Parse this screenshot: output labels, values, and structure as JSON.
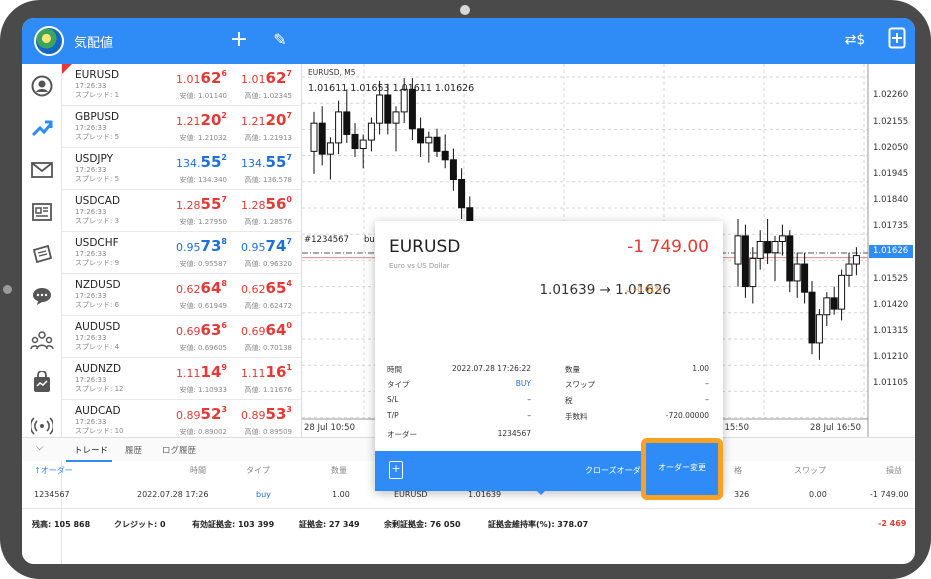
{
  "header": {
    "title": "気配値"
  },
  "quotes": [
    {
      "symbol": "EURUSD",
      "time": "17:26:33",
      "spread": "スプレッド: 1",
      "bid_main": "1.01",
      "bid_big": "62",
      "bid_sup": "6",
      "ask_main": "1.01",
      "ask_big": "62",
      "ask_sup": "7",
      "low": "安値: 1.01140",
      "high": "高値: 1.02345",
      "color": "red"
    },
    {
      "symbol": "GBPUSD",
      "time": "17:26:33",
      "spread": "スプレッド: 5",
      "bid_main": "1.21",
      "bid_big": "20",
      "bid_sup": "2",
      "ask_main": "1.21",
      "ask_big": "20",
      "ask_sup": "7",
      "low": "安値: 1.21032",
      "high": "高値: 1.21913",
      "color": "red"
    },
    {
      "symbol": "USDJPY",
      "time": "17:26:33",
      "spread": "スプレッド: 5",
      "bid_main": "134.",
      "bid_big": "55",
      "bid_sup": "2",
      "ask_main": "134.",
      "ask_big": "55",
      "ask_sup": "7",
      "low": "安値: 134.340",
      "high": "高値: 136.578",
      "color": "blue"
    },
    {
      "symbol": "USDCAD",
      "time": "17:26:33",
      "spread": "スプレッド: 3",
      "bid_main": "1.28",
      "bid_big": "55",
      "bid_sup": "7",
      "ask_main": "1.28",
      "ask_big": "56",
      "ask_sup": "0",
      "low": "安値: 1.27950",
      "high": "高値: 1.28576",
      "color": "red"
    },
    {
      "symbol": "USDCHF",
      "time": "17:26:33",
      "spread": "スプレッド: 9",
      "bid_main": "0.95",
      "bid_big": "73",
      "bid_sup": "8",
      "ask_main": "0.95",
      "ask_big": "74",
      "ask_sup": "7",
      "low": "安値: 0.95587",
      "high": "高値: 0.96320",
      "color": "blue"
    },
    {
      "symbol": "NZDUSD",
      "time": "17:26:33",
      "spread": "スプレッド: 6",
      "bid_main": "0.62",
      "bid_big": "64",
      "bid_sup": "8",
      "ask_main": "0.62",
      "ask_big": "65",
      "ask_sup": "4",
      "low": "安値: 0.61949",
      "high": "高値: 0.62472",
      "color": "red"
    },
    {
      "symbol": "AUDUSD",
      "time": "17:26:33",
      "spread": "スプレッド: 4",
      "bid_main": "0.69",
      "bid_big": "63",
      "bid_sup": "6",
      "ask_main": "0.69",
      "ask_big": "64",
      "ask_sup": "0",
      "low": "安値: 0.69605",
      "high": "高値: 0.70138",
      "color": "red"
    },
    {
      "symbol": "AUDNZD",
      "time": "17:26:33",
      "spread": "スプレッド: 12",
      "bid_main": "1.11",
      "bid_big": "14",
      "bid_sup": "9",
      "ask_main": "1.11",
      "ask_big": "16",
      "ask_sup": "1",
      "low": "安値: 1.10933",
      "high": "高値: 1.11676",
      "color": "red"
    },
    {
      "symbol": "AUDCAD",
      "time": "17:26:33",
      "spread": "スプレッド: 10",
      "bid_main": "0.89",
      "bid_big": "52",
      "bid_sup": "3",
      "ask_main": "0.89",
      "ask_big": "53",
      "ask_sup": "3",
      "low": "安値: 0.89002",
      "high": "高値: 0.89509",
      "color": "red"
    }
  ],
  "chart": {
    "title": "EURUSD, M5",
    "ohlc": "1.01611 1.01653 1.01611 1.01626",
    "order_label": "#1234567",
    "order_label2": "bu",
    "current_price": "1.01626",
    "price_labels": [
      "1.02260",
      "1.02155",
      "1.02050",
      "1.01945",
      "1.01840",
      "1.01735",
      "1.01525",
      "1.01420",
      "1.01315",
      "1.01210",
      "1.01105"
    ],
    "time_labels": [
      "28 Jul 10:50",
      "28 Jul 15:50",
      "28 Jul 16:50"
    ]
  },
  "chart_data": {
    "type": "candlestick",
    "title": "EURUSD, M5",
    "ylim": [
      1.0105,
      1.0231
    ],
    "candles_left": [
      [
        1.02,
        1.0214,
        1.0192,
        1.021
      ],
      [
        1.021,
        1.0216,
        1.0195,
        1.0199
      ],
      [
        1.0199,
        1.0205,
        1.019,
        1.0203
      ],
      [
        1.0203,
        1.0218,
        1.0199,
        1.0214
      ],
      [
        1.0214,
        1.0222,
        1.0203,
        1.0206
      ],
      [
        1.0206,
        1.021,
        1.0198,
        1.0201
      ],
      [
        1.0201,
        1.0206,
        1.0194,
        1.0204
      ],
      [
        1.0204,
        1.0212,
        1.02,
        1.021
      ],
      [
        1.021,
        1.0225,
        1.0206,
        1.022
      ],
      [
        1.022,
        1.0224,
        1.0206,
        1.021
      ],
      [
        1.021,
        1.0216,
        1.02,
        1.0214
      ],
      [
        1.0214,
        1.0226,
        1.021,
        1.0222
      ],
      [
        1.0222,
        1.0226,
        1.0204,
        1.0208
      ],
      [
        1.0208,
        1.0212,
        1.0198,
        1.0203
      ],
      [
        1.0203,
        1.0207,
        1.0196,
        1.0205
      ],
      [
        1.0205,
        1.0208,
        1.0198,
        1.02
      ],
      [
        1.02,
        1.0206,
        1.0194,
        1.0197
      ],
      [
        1.0197,
        1.0201,
        1.0186,
        1.019
      ],
      [
        1.019,
        1.0194,
        1.0176,
        1.018
      ],
      [
        1.018,
        1.0184,
        1.0166,
        1.017
      ]
    ],
    "candles_right": [
      [
        1.016,
        1.0176,
        1.0152,
        1.017
      ],
      [
        1.017,
        1.0174,
        1.0148,
        1.0152
      ],
      [
        1.0152,
        1.0166,
        1.0146,
        1.0162
      ],
      [
        1.0162,
        1.0172,
        1.0158,
        1.0168
      ],
      [
        1.0168,
        1.0176,
        1.016,
        1.0164
      ],
      [
        1.0164,
        1.017,
        1.0154,
        1.0168
      ],
      [
        1.0168,
        1.0174,
        1.0163,
        1.017
      ],
      [
        1.017,
        1.0172,
        1.015,
        1.0154
      ],
      [
        1.0154,
        1.0164,
        1.0148,
        1.016
      ],
      [
        1.016,
        1.0164,
        1.0146,
        1.015
      ],
      [
        1.015,
        1.0154,
        1.0128,
        1.0132
      ],
      [
        1.0132,
        1.0144,
        1.0126,
        1.0142
      ],
      [
        1.0142,
        1.015,
        1.0138,
        1.0148
      ],
      [
        1.0148,
        1.0152,
        1.0142,
        1.0144
      ],
      [
        1.0144,
        1.0158,
        1.014,
        1.0156
      ],
      [
        1.0156,
        1.0164,
        1.0152,
        1.016
      ],
      [
        1.016,
        1.0166,
        1.0156,
        1.0163
      ]
    ],
    "order_line": 1.01639,
    "current_line": 1.01626
  },
  "popup": {
    "symbol": "EURUSD",
    "description": "Euro vs US Dollar",
    "profit": "-1 749.00",
    "price_move": "1.01639 → 1.01626",
    "change": "-0.01%",
    "rows_left": [
      {
        "label": "時間",
        "value": "2022.07.28 17:26:22"
      },
      {
        "label": "タイプ",
        "value": "BUY"
      },
      {
        "label": "S/L",
        "value": "–"
      },
      {
        "label": "T/P",
        "value": "–"
      },
      {
        "label": "オーダー",
        "value": "1234567"
      }
    ],
    "rows_right": [
      {
        "label": "数量",
        "value": "1.00"
      },
      {
        "label": "スワップ",
        "value": "–"
      },
      {
        "label": "税",
        "value": "–"
      },
      {
        "label": "手数料",
        "value": "-720.00000"
      }
    ],
    "close_label": "クローズオーダ",
    "modify_label": "オーダー変更"
  },
  "bottom": {
    "tabs": [
      "トレード",
      "履歴",
      "ログ履歴"
    ],
    "columns": [
      "↑オーダー",
      "時間",
      "タイプ",
      "数量",
      "格",
      "スワップ",
      "損益"
    ],
    "row": {
      "order": "1234567",
      "time": "2022.07.28 17:26",
      "type": "buy",
      "volume": "1.00",
      "symbol": "EURUSD",
      "price": "1.01639",
      "current": "326",
      "swap": "0.00",
      "profit": "-1 749.00"
    },
    "summary": [
      "残高: 105 868",
      "クレジット: 0",
      "有効証拠金: 103 399",
      "証拠金: 27 349",
      "余剰証拠金: 76 050",
      "証拠金維持率(%): 378.07"
    ],
    "summary_profit": "-2 469"
  }
}
